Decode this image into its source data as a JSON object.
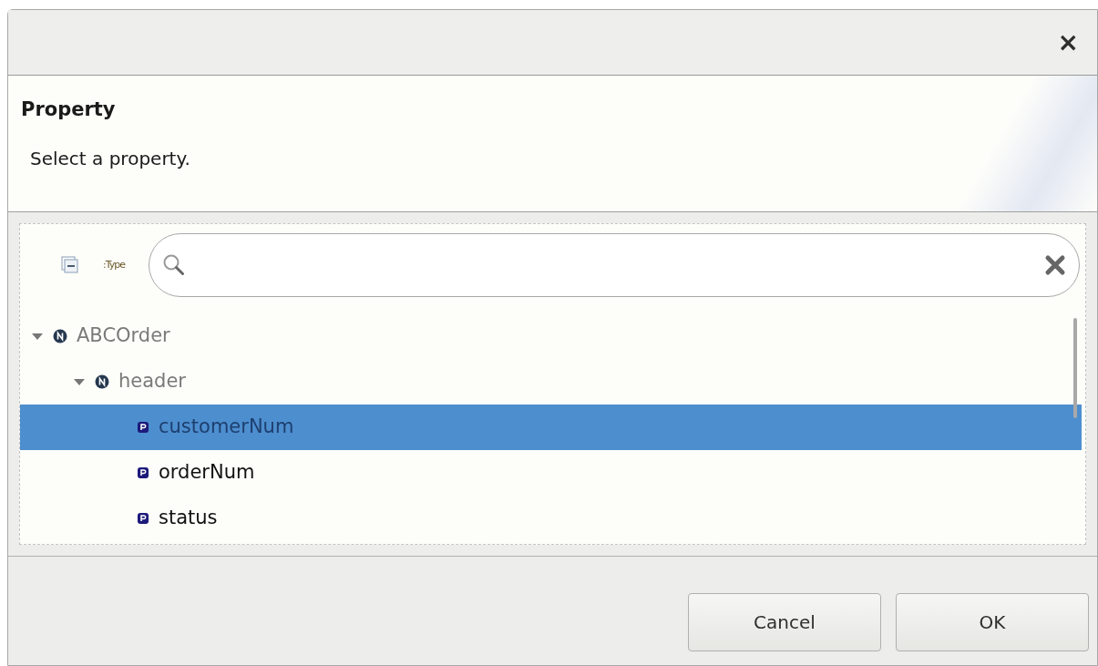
{
  "dialog": {
    "close_glyph": "×",
    "title": "Property",
    "message": "Select a property."
  },
  "toolbar": {
    "type_toggle": ":Type"
  },
  "tree": [
    {
      "label": "ABCOrder",
      "kind": "node",
      "expanded": true,
      "selected": false,
      "children": [
        {
          "label": "header",
          "kind": "node",
          "expanded": true,
          "selected": false,
          "children": [
            {
              "label": "customerNum",
              "kind": "property",
              "selected": true
            },
            {
              "label": "orderNum",
              "kind": "property",
              "selected": false
            },
            {
              "label": "status",
              "kind": "property",
              "selected": false
            }
          ]
        }
      ]
    }
  ],
  "buttons": [
    {
      "label": "Cancel"
    },
    {
      "label": "OK"
    }
  ]
}
